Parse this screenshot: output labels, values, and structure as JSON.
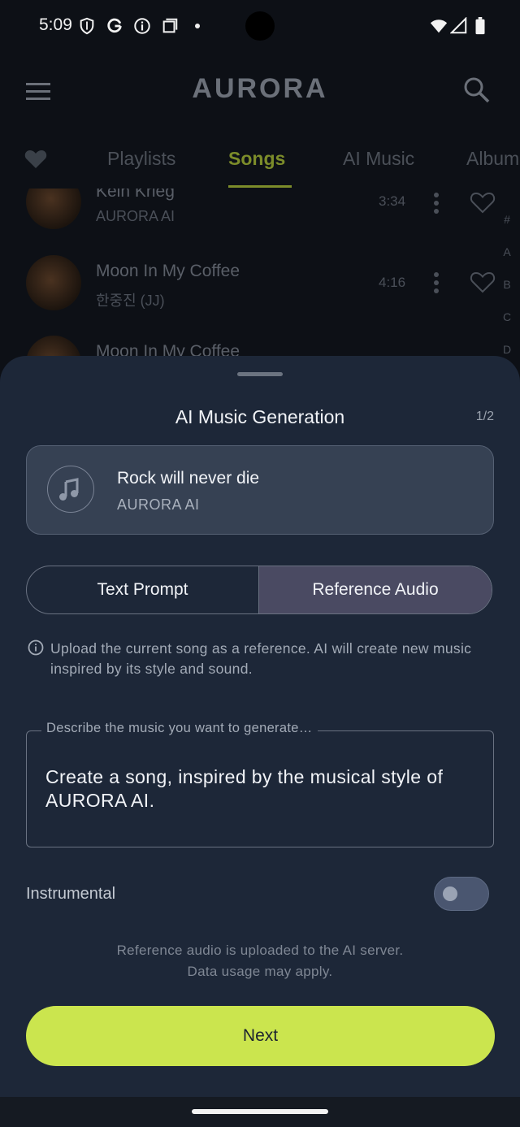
{
  "status_bar": {
    "time": "5:09",
    "icons": [
      "shield-icon",
      "google-icon",
      "info-icon",
      "square-icon",
      "dot",
      "wifi-icon",
      "signal-icon",
      "battery-icon"
    ]
  },
  "app_bar": {
    "logo": "AURORA",
    "icons": [
      "menu-icon",
      "search-icon"
    ]
  },
  "tabs": {
    "items": [
      "Playlists",
      "Songs",
      "AI Music",
      "Album"
    ],
    "active": "Songs"
  },
  "songs": [
    {
      "title": "Kein Krieg",
      "artist": "AURORA AI",
      "duration": "3:34"
    },
    {
      "title": "Moon In My Coffee",
      "artist": "한중진 (JJ)",
      "duration": "4:16"
    },
    {
      "title": "Moon In My Coffee",
      "artist": "",
      "duration": ""
    }
  ],
  "alpha_index": [
    "#",
    "A",
    "B",
    "C",
    "D"
  ],
  "sheet": {
    "title": "AI Music Generation",
    "step": "1/2",
    "song_card": {
      "title": "Rock will never die",
      "artist": "AURORA AI"
    },
    "segments": {
      "left": "Text Prompt",
      "right": "Reference Audio",
      "selected": "Reference Audio"
    },
    "info_text": "Upload the current song as a reference. AI will create new music inspired by its style and sound.",
    "prompt": {
      "label": "Describe the music you want to generate…",
      "value": "Create a song, inspired by the musical style of AURORA AI."
    },
    "instrumental": {
      "label": "Instrumental",
      "enabled": false
    },
    "note_lines": [
      "Reference audio is uploaded to the AI server.",
      "Data usage may apply."
    ],
    "next_label": "Next"
  },
  "colors": {
    "accent": "#cbe54e",
    "sheet_bg": "#1d2738",
    "segment_selected": "#4a4a62"
  }
}
